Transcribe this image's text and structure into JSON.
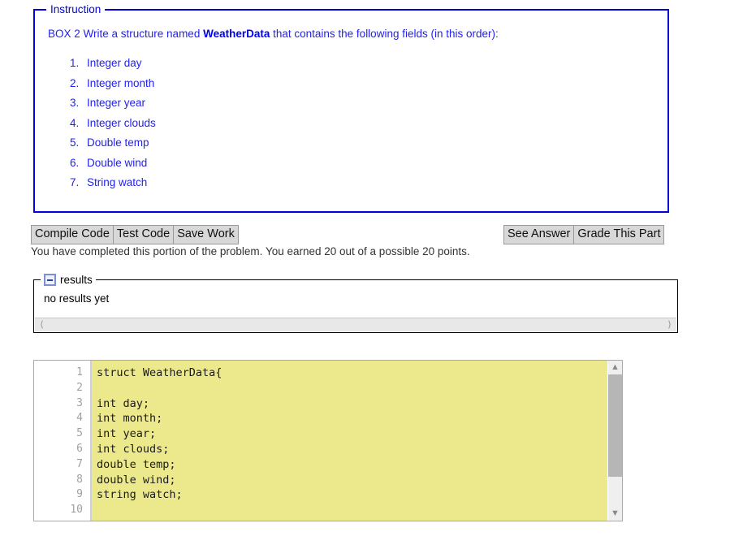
{
  "instruction": {
    "legend": "Instruction",
    "prefix": "BOX 2 Write a structure named ",
    "emphasis": "WeatherData",
    "suffix": " that contains the following fields (in this order):",
    "fields": [
      "Integer day",
      "Integer month",
      "Integer year",
      "Integer clouds",
      "Double temp",
      "Double wind",
      "String watch"
    ]
  },
  "toolbar": {
    "compile_label": "Compile Code",
    "test_label": "Test Code",
    "save_label": "Save Work",
    "see_answer_label": "See Answer",
    "grade_label": "Grade This Part"
  },
  "status": {
    "text": "You have completed this portion of the problem. You earned 20 out of a possible 20 points.",
    "earned": "20",
    "possible": "20"
  },
  "results": {
    "legend": "results",
    "collapse_icon": "minus-box-icon",
    "body": "no results yet",
    "scroll_left_icon": "chevron-left-icon",
    "scroll_right_icon": "chevron-right-icon"
  },
  "editor": {
    "line_numbers": [
      "1",
      "2",
      "3",
      "4",
      "5",
      "6",
      "7",
      "8",
      "9",
      "10"
    ],
    "lines": [
      "struct WeatherData{",
      "",
      "int day;",
      "int month;",
      "int year;",
      "int clouds;",
      "double temp;",
      "double wind;",
      "string watch;",
      ""
    ],
    "scroll_up_icon": "chevron-up-icon",
    "scroll_down_icon": "chevron-down-icon",
    "background_color": "#ece98d"
  },
  "colors": {
    "instruction_border": "#0000e0",
    "instruction_text": "#2222ee",
    "button_face": "#d8d8d8",
    "code_background": "#ece98d"
  }
}
